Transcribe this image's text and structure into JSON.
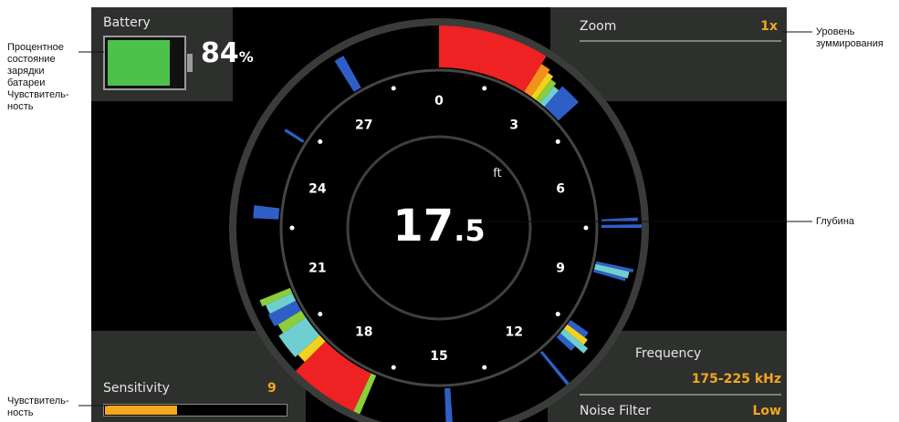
{
  "callouts": {
    "battery": [
      "Процентное",
      "состояние",
      "зарядки",
      "батареи",
      "Чувствитель-",
      "ность"
    ],
    "zoom": [
      "Уровень",
      "зуммирования"
    ],
    "depth": [
      "Глубина"
    ],
    "sensitivity": [
      "Чувствитель-",
      "ность"
    ]
  },
  "battery": {
    "label": "Battery",
    "percent_number": "84",
    "percent_sign": "%",
    "level": 0.84
  },
  "zoom": {
    "label": "Zoom",
    "value": "1x"
  },
  "depth": {
    "whole": "17",
    "decimal": ".5",
    "unit": "ft"
  },
  "dial": {
    "ticks": [
      "0",
      "3",
      "6",
      "9",
      "12",
      "15",
      "18",
      "21",
      "24",
      "27"
    ]
  },
  "sensitivity": {
    "label": "Sensitivity",
    "value": "9",
    "level": 0.4
  },
  "frequency": {
    "label": "Frequency",
    "value": "175-225 kHz"
  },
  "noise_filter": {
    "label": "Noise Filter",
    "value": "Low"
  },
  "colors": {
    "accent": "#f2a71d",
    "battery_fill": "#4cc24a",
    "signal_red": "#ee2222",
    "signal_blue": "#2f5fc6",
    "panel": "#2e302e"
  }
}
